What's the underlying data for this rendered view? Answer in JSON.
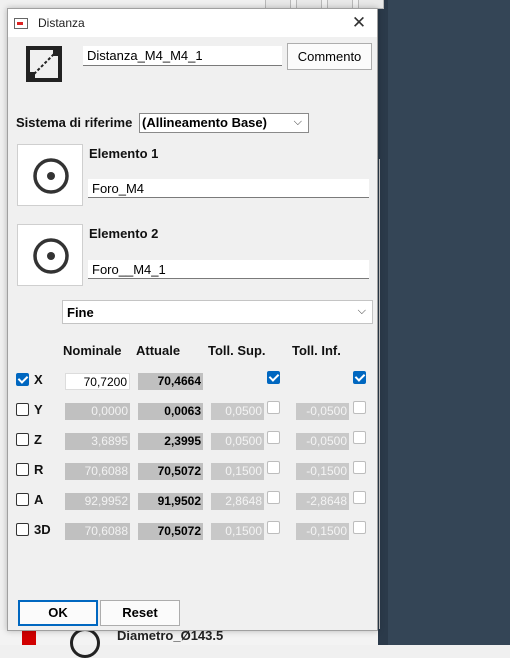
{
  "window": {
    "title": "Distanza"
  },
  "header": {
    "name_value": "Distanza_M4_M4_1",
    "comment_label": "Commento"
  },
  "reference": {
    "label": "Sistema di riferime",
    "selected": "(Allineamento Base)"
  },
  "element1": {
    "label": "Elemento 1",
    "value": "Foro_M4"
  },
  "element2": {
    "label": "Elemento 2",
    "value": "Foro__M4_1"
  },
  "mode": {
    "selected": "Fine"
  },
  "columns": {
    "nominal": "Nominale",
    "actual": "Attuale",
    "tol_sup": "Toll. Sup.",
    "tol_inf": "Toll. Inf."
  },
  "rows": [
    {
      "label": "X",
      "checked": true,
      "nominal": "70,7200",
      "actual": "70,4664",
      "tol_sup": "",
      "tol_inf": "",
      "tol_sup_checked": true,
      "tol_inf_checked": true
    },
    {
      "label": "Y",
      "checked": false,
      "nominal": "0,0000",
      "actual": "0,0063",
      "tol_sup": "0,0500",
      "tol_inf": "-0,0500",
      "tol_sup_checked": false,
      "tol_inf_checked": false
    },
    {
      "label": "Z",
      "checked": false,
      "nominal": "3,6895",
      "actual": "2,3995",
      "tol_sup": "0,0500",
      "tol_inf": "-0,0500",
      "tol_sup_checked": false,
      "tol_inf_checked": false
    },
    {
      "label": "R",
      "checked": false,
      "nominal": "70,6088",
      "actual": "70,5072",
      "tol_sup": "0,1500",
      "tol_inf": "-0,1500",
      "tol_sup_checked": false,
      "tol_inf_checked": false
    },
    {
      "label": "A",
      "checked": false,
      "nominal": "92,9952",
      "actual": "91,9502",
      "tol_sup": "2,8648",
      "tol_inf": "-2,8648",
      "tol_sup_checked": false,
      "tol_inf_checked": false
    },
    {
      "label": "3D",
      "checked": false,
      "nominal": "70,6088",
      "actual": "70,5072",
      "tol_sup": "0,1500",
      "tol_inf": "-0,1500",
      "tol_sup_checked": false,
      "tol_inf_checked": false
    }
  ],
  "footer": {
    "ok_label": "OK",
    "reset_label": "Reset"
  },
  "background": {
    "feature_text": "Diametro_Ø143.5"
  },
  "colors": {
    "accent": "#0067c0",
    "readonly": "#c0c0c0"
  }
}
